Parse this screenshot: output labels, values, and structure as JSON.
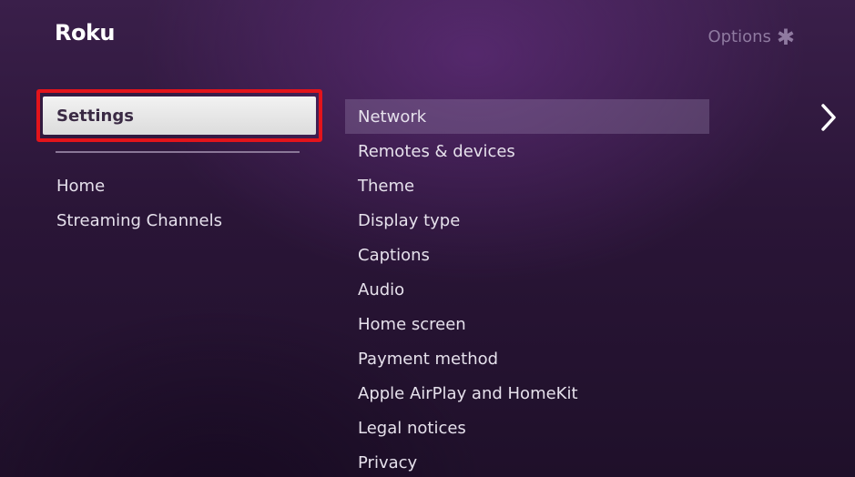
{
  "header": {
    "logo_text": "Roku",
    "options_label": "Options",
    "options_icon_glyph": "✱"
  },
  "left_menu": {
    "selected_label": "Settings",
    "items": [
      {
        "label": "Home"
      },
      {
        "label": "Streaming Channels"
      }
    ]
  },
  "settings_menu": {
    "items": [
      {
        "label": "Network",
        "selected": true
      },
      {
        "label": "Remotes & devices"
      },
      {
        "label": "Theme"
      },
      {
        "label": "Display type"
      },
      {
        "label": "Captions"
      },
      {
        "label": "Audio"
      },
      {
        "label": "Home screen"
      },
      {
        "label": "Payment method"
      },
      {
        "label": "Apple AirPlay and HomeKit"
      },
      {
        "label": "Legal notices"
      },
      {
        "label": "Privacy"
      }
    ]
  },
  "icons": {
    "next": "chevron-right-icon",
    "options": "asterisk-icon"
  },
  "colors": {
    "highlight_border": "#e3141b",
    "background": "#2a1537",
    "selected_row": "#5a4468"
  }
}
